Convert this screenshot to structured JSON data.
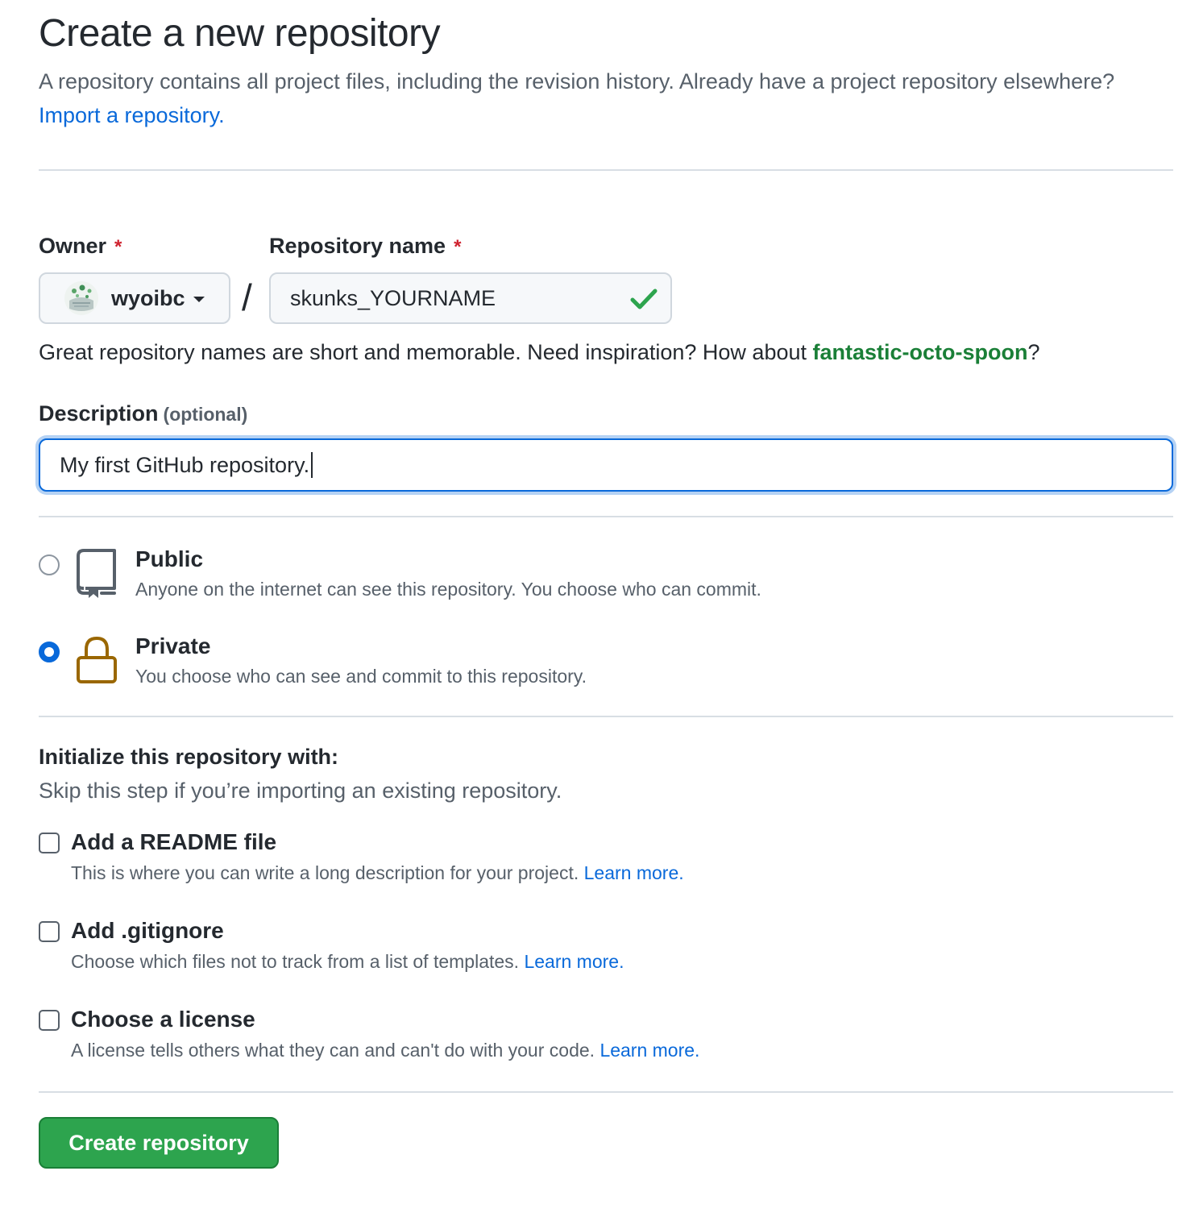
{
  "header": {
    "title": "Create a new repository",
    "subtitle": "A repository contains all project files, including the revision history. Already have a project repository elsewhere?",
    "import_link": "Import a repository."
  },
  "owner": {
    "label": "Owner",
    "required_mark": "*",
    "value": "wyoibc"
  },
  "repo_name": {
    "label": "Repository name",
    "required_mark": "*",
    "value": "skunks_YOURNAME",
    "separator": "/"
  },
  "hint": {
    "text": "Great repository names are short and memorable. Need inspiration? How about",
    "suggestion": "fantastic-octo-spoon",
    "suffix": "?"
  },
  "description": {
    "label": "Description",
    "optional": "(optional)",
    "value": "My first GitHub repository."
  },
  "visibility": {
    "selected": "private",
    "options": [
      {
        "title": "Public",
        "desc": "Anyone on the internet can see this repository. You choose who can commit.",
        "icon": "repo-icon"
      },
      {
        "title": "Private",
        "desc": "You choose who can see and commit to this repository.",
        "icon": "lock-icon"
      }
    ]
  },
  "initialize": {
    "title": "Initialize this repository with:",
    "subtitle": "Skip this step if you’re importing an existing repository.",
    "options": [
      {
        "title": "Add a README file",
        "desc": "This is where you can write a long description for your project.",
        "link": "Learn more.",
        "checked": false
      },
      {
        "title": "Add .gitignore",
        "desc": "Choose which files not to track from a list of templates.",
        "link": "Learn more.",
        "checked": false
      },
      {
        "title": "Choose a license",
        "desc": "A license tells others what they can and can't do with your code.",
        "link": "Learn more.",
        "checked": false
      }
    ]
  },
  "submit": {
    "label": "Create repository"
  },
  "colors": {
    "accent": "#0969da",
    "success": "#2da44e",
    "suggestion": "#1a7f37",
    "required": "#cf222e",
    "lock": "#9a6700"
  }
}
